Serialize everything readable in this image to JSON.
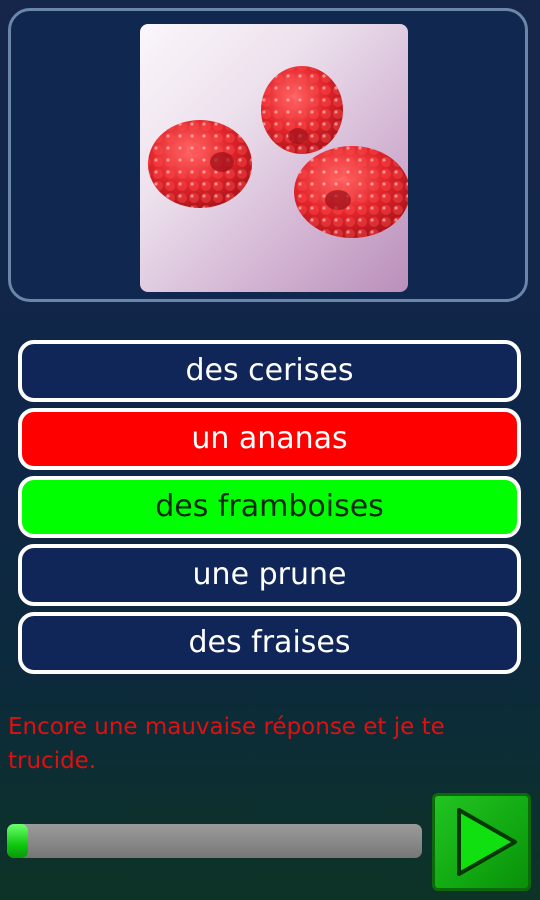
{
  "question": {
    "image": "raspberries-photo"
  },
  "answers": [
    {
      "label": "des cerises",
      "state": "neutral"
    },
    {
      "label": "un ananas",
      "state": "wrong"
    },
    {
      "label": "des framboises",
      "state": "correct"
    },
    {
      "label": "une prune",
      "state": "neutral"
    },
    {
      "label": "des fraises",
      "state": "neutral"
    }
  ],
  "feedback": {
    "message": "Encore une mauvaise réponse et je te trucide."
  },
  "progress": {
    "value": 0.05
  },
  "next": {
    "icon": "play-arrow-icon"
  },
  "colors": {
    "wrong": "#ff0000",
    "correct": "#00ff00",
    "neutral": "#102659",
    "message": "#e01010"
  }
}
